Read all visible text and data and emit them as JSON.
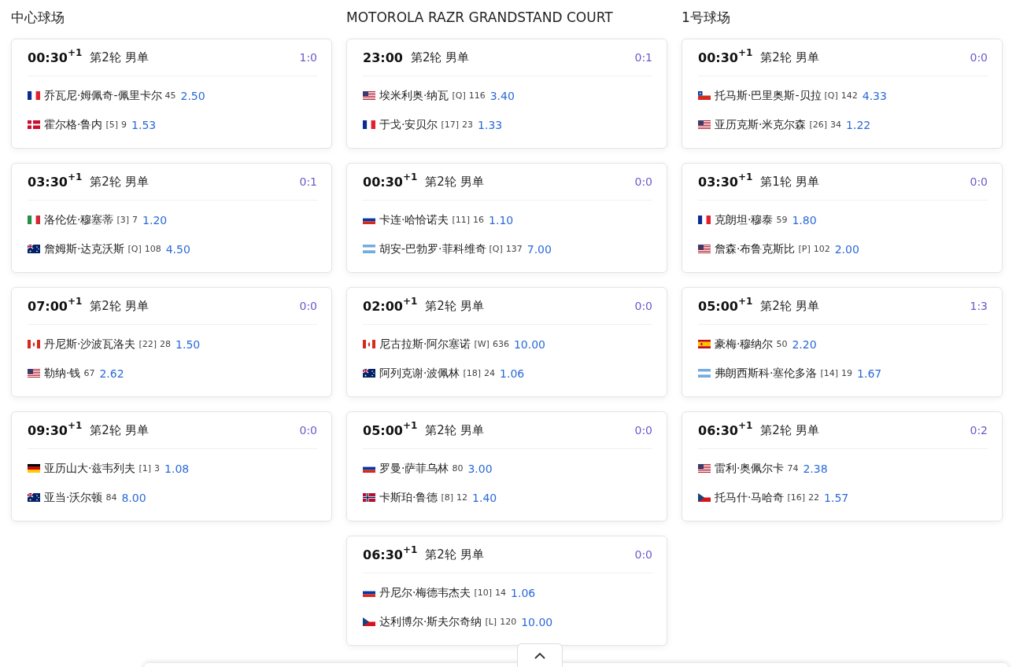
{
  "courts": [
    {
      "name": "中心球场",
      "matches": [
        {
          "time": "00:30",
          "day_offset": "+1",
          "round": "第2轮 男单",
          "score": "1:0",
          "players": [
            {
              "kind": "fr",
              "name": "乔瓦尼·姆佩奇-佩里卡尔",
              "rank": "45",
              "odds": "2.50"
            },
            {
              "kind": "dk",
              "name": "霍尔格·鲁内",
              "seed": "[5]",
              "rank": "9",
              "odds": "1.53"
            }
          ]
        },
        {
          "time": "03:30",
          "day_offset": "+1",
          "round": "第2轮 男单",
          "score": "0:1",
          "players": [
            {
              "kind": "it",
              "name": "洛伦佐·穆塞蒂",
              "seed": "[3]",
              "rank": "7",
              "odds": "1.20"
            },
            {
              "kind": "au",
              "name": "詹姆斯·达克沃斯",
              "seed": "[Q]",
              "rank": "108",
              "odds": "4.50"
            }
          ]
        },
        {
          "time": "07:00",
          "day_offset": "+1",
          "round": "第2轮 男单",
          "score": "0:0",
          "players": [
            {
              "kind": "ca",
              "name": "丹尼斯·沙波瓦洛夫",
              "seed": "[22]",
              "rank": "28",
              "odds": "1.50"
            },
            {
              "kind": "us",
              "name": "勒纳·钱",
              "rank": "67",
              "odds": "2.62"
            }
          ]
        },
        {
          "time": "09:30",
          "day_offset": "+1",
          "round": "第2轮 男单",
          "score": "0:0",
          "players": [
            {
              "kind": "de",
              "name": "亚历山大·兹韦列夫",
              "seed": "[1]",
              "rank": "3",
              "odds": "1.08"
            },
            {
              "kind": "au",
              "name": "亚当·沃尔顿",
              "rank": "84",
              "odds": "8.00"
            }
          ]
        }
      ]
    },
    {
      "name": "MOTOROLA RAZR GRANDSTAND COURT",
      "matches": [
        {
          "time": "23:00",
          "round": "第2轮 男单",
          "score": "0:1",
          "players": [
            {
              "kind": "us",
              "name": "埃米利奥·纳瓦",
              "seed": "[Q]",
              "rank": "116",
              "odds": "3.40"
            },
            {
              "kind": "fr",
              "name": "于戈·安贝尔",
              "seed": "[17]",
              "rank": "23",
              "odds": "1.33"
            }
          ]
        },
        {
          "time": "00:30",
          "day_offset": "+1",
          "round": "第2轮 男单",
          "score": "0:0",
          "players": [
            {
              "kind": "ru",
              "name": "卡连·哈恰诺夫",
              "seed": "[11]",
              "rank": "16",
              "odds": "1.10"
            },
            {
              "kind": "ar",
              "name": "胡安-巴勃罗·菲科维奇",
              "seed": "[Q]",
              "rank": "137",
              "odds": "7.00"
            }
          ]
        },
        {
          "time": "02:00",
          "day_offset": "+1",
          "round": "第2轮 男单",
          "score": "0:0",
          "players": [
            {
              "kind": "ca",
              "name": "尼古拉斯·阿尔塞诺",
              "seed": "[W]",
              "rank": "636",
              "odds": "10.00"
            },
            {
              "kind": "au",
              "name": "阿列克谢·波佩林",
              "seed": "[18]",
              "rank": "24",
              "odds": "1.06"
            }
          ]
        },
        {
          "time": "05:00",
          "day_offset": "+1",
          "round": "第2轮 男单",
          "score": "0:0",
          "players": [
            {
              "kind": "ru",
              "name": "罗曼·萨菲乌林",
              "rank": "80",
              "odds": "3.00"
            },
            {
              "kind": "no",
              "name": "卡斯珀·鲁德",
              "seed": "[8]",
              "rank": "12",
              "odds": "1.40"
            }
          ]
        },
        {
          "time": "06:30",
          "day_offset": "+1",
          "round": "第2轮 男单",
          "score": "0:0",
          "players": [
            {
              "kind": "ru",
              "name": "丹尼尔·梅德韦杰夫",
              "seed": "[10]",
              "rank": "14",
              "odds": "1.06"
            },
            {
              "kind": "cz",
              "name": "达利博尔·斯夫尔奇纳",
              "seed": "[L]",
              "rank": "120",
              "odds": "10.00"
            }
          ]
        }
      ]
    },
    {
      "name": "1号球场",
      "matches": [
        {
          "time": "00:30",
          "day_offset": "+1",
          "round": "第2轮 男单",
          "score": "0:0",
          "players": [
            {
              "kind": "cl",
              "name": "托马斯·巴里奥斯-贝拉",
              "seed": "[Q]",
              "rank": "142",
              "odds": "4.33"
            },
            {
              "kind": "us",
              "name": "亚历克斯·米克尔森",
              "seed": "[26]",
              "rank": "34",
              "odds": "1.22"
            }
          ]
        },
        {
          "time": "03:30",
          "day_offset": "+1",
          "round": "第1轮 男单",
          "score": "0:0",
          "players": [
            {
              "kind": "fr",
              "name": "克朗坦·穆泰",
              "rank": "59",
              "odds": "1.80"
            },
            {
              "kind": "us",
              "name": "詹森·布鲁克斯比",
              "seed": "[P]",
              "rank": "102",
              "odds": "2.00"
            }
          ]
        },
        {
          "time": "05:00",
          "day_offset": "+1",
          "round": "第2轮 男单",
          "score": "1:3",
          "players": [
            {
              "kind": "es",
              "name": "豪梅·穆纳尔",
              "rank": "50",
              "odds": "2.20"
            },
            {
              "kind": "ar",
              "name": "弗朗西斯科·塞伦多洛",
              "seed": "[14]",
              "rank": "19",
              "odds": "1.67"
            }
          ]
        },
        {
          "time": "06:30",
          "day_offset": "+1",
          "round": "第2轮 男单",
          "score": "0:2",
          "players": [
            {
              "kind": "us",
              "name": "雷利·奥佩尔卡",
              "rank": "74",
              "odds": "2.38"
            },
            {
              "kind": "cz",
              "name": "托马什·马哈奇",
              "seed": "[16]",
              "rank": "22",
              "odds": "1.57"
            }
          ]
        }
      ]
    }
  ]
}
